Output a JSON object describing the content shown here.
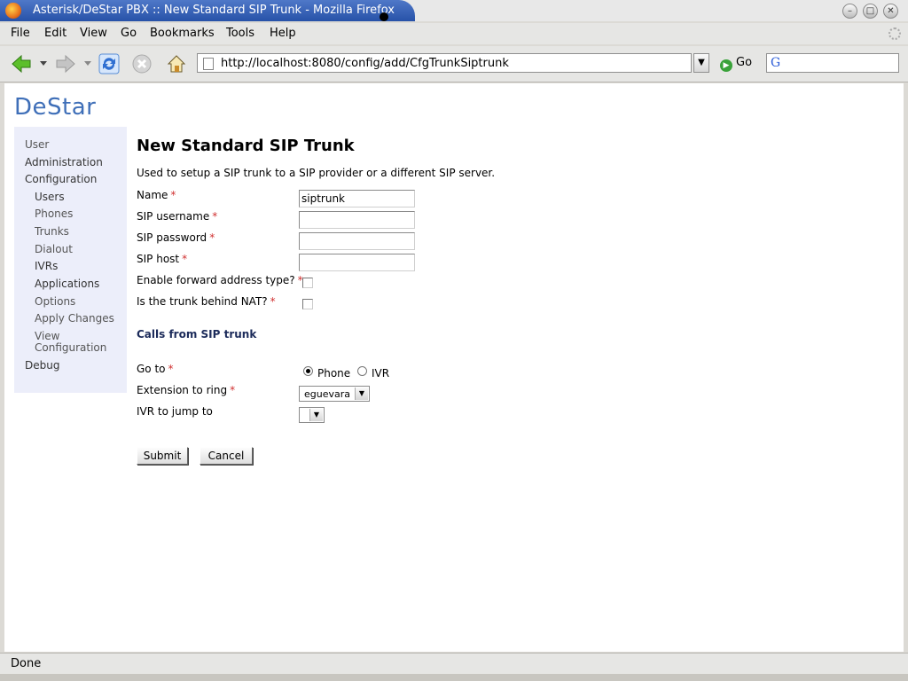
{
  "window": {
    "title": "Asterisk/DeStar PBX :: New Standard SIP Trunk - Mozilla Firefox"
  },
  "menu": [
    "File",
    "Edit",
    "View",
    "Go",
    "Bookmarks",
    "Tools",
    "Help"
  ],
  "navbar": {
    "url": "http://localhost:8080/config/add/CfgTrunkSiptrunk",
    "go_label": "Go",
    "search_value": ""
  },
  "page": {
    "logo": "DeStar",
    "sidebar": [
      {
        "label": "User"
      },
      {
        "label": "Administration"
      },
      {
        "label": "Configuration"
      },
      {
        "label": "Users"
      },
      {
        "label": "Phones"
      },
      {
        "label": "Trunks"
      },
      {
        "label": "Dialout"
      },
      {
        "label": "IVRs"
      },
      {
        "label": "Applications"
      },
      {
        "label": "Options"
      },
      {
        "label": "Apply Changes"
      },
      {
        "label": "View"
      },
      {
        "label": "Configuration"
      },
      {
        "label": "Debug"
      }
    ],
    "title": "New Standard SIP Trunk",
    "description": "Used to setup a SIP trunk to a SIP provider or a different SIP server.",
    "fields": {
      "name_label": "Name",
      "name_value": "siptrunk",
      "username_label": "SIP username",
      "username_value": "",
      "password_label": "SIP password",
      "password_value": "",
      "host_label": "SIP host",
      "host_value": "",
      "forward_label": "Enable forward address type?",
      "nat_label": "Is the trunk behind NAT?",
      "required_mark": "*"
    },
    "calls_section": "Calls from SIP trunk",
    "goto": {
      "label": "Go to",
      "options": [
        "Phone",
        "IVR"
      ],
      "selected": "Phone"
    },
    "extension": {
      "label": "Extension to ring",
      "value": "eguevara"
    },
    "ivr": {
      "label": "IVR to jump to",
      "value": ""
    },
    "buttons": {
      "submit": "Submit",
      "cancel": "Cancel"
    }
  },
  "status": "Done"
}
